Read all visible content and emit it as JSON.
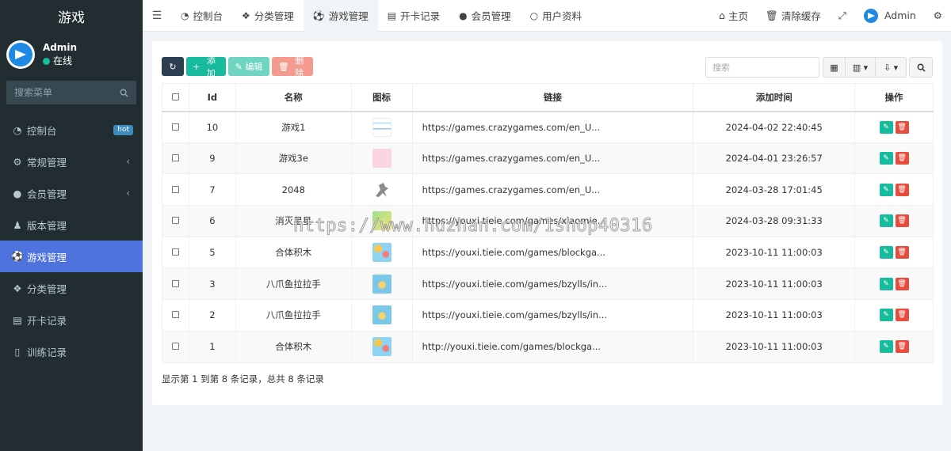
{
  "sidebar": {
    "brand": "游戏",
    "user": {
      "name": "Admin",
      "status": "在线"
    },
    "search_placeholder": "搜索菜单",
    "items": [
      {
        "label": "控制台",
        "icon": "dashboard-icon",
        "badge": "hot"
      },
      {
        "label": "常规管理",
        "icon": "cogs-icon"
      },
      {
        "label": "会员管理",
        "icon": "user-circle-icon"
      },
      {
        "label": "版本管理",
        "icon": "users-icon"
      },
      {
        "label": "游戏管理",
        "icon": "futbol-icon",
        "active": true
      },
      {
        "label": "分类管理",
        "icon": "cubes-icon"
      },
      {
        "label": "开卡记录",
        "icon": "id-card-icon"
      },
      {
        "label": "训练记录",
        "icon": "book-icon"
      }
    ]
  },
  "topbar": {
    "tabs": [
      {
        "label": "控制台",
        "icon": "dashboard-icon"
      },
      {
        "label": "分类管理",
        "icon": "cubes-icon"
      },
      {
        "label": "游戏管理",
        "icon": "futbol-icon",
        "active": true
      },
      {
        "label": "开卡记录",
        "icon": "id-card-icon"
      },
      {
        "label": "会员管理",
        "icon": "user-icon"
      },
      {
        "label": "用户资料",
        "icon": "circle-icon"
      }
    ],
    "home_label": "主页",
    "clear_cache_label": "清除缓存",
    "user_label": "Admin"
  },
  "toolbar": {
    "add_label": "添加",
    "edit_label": "编辑",
    "delete_label": "删除",
    "search_placeholder": "搜索"
  },
  "table": {
    "headers": {
      "id": "Id",
      "name": "名称",
      "icon": "图标",
      "link": "链接",
      "time": "添加时间",
      "ops": "操作"
    },
    "rows": [
      {
        "id": "10",
        "name": "游戏1",
        "link": "https://games.crazygames.com/en_U...",
        "time": "2024-04-02 22:40:45"
      },
      {
        "id": "9",
        "name": "游戏3e",
        "link": "https://games.crazygames.com/en_U...",
        "time": "2024-04-01 23:26:57"
      },
      {
        "id": "7",
        "name": "2048",
        "link": "https://games.crazygames.com/en_U...",
        "time": "2024-03-28 17:01:45"
      },
      {
        "id": "6",
        "name": "消灭星星",
        "link": "https://youxi.tieie.com/games/xiaomie...",
        "time": "2024-03-28 09:31:33"
      },
      {
        "id": "5",
        "name": "合体积木",
        "link": "https://youxi.tieie.com/games/blockga...",
        "time": "2023-10-11 11:00:03"
      },
      {
        "id": "3",
        "name": "八爪鱼拉拉手",
        "link": "https://youxi.tieie.com/games/bzylls/in...",
        "time": "2023-10-11 11:00:03"
      },
      {
        "id": "2",
        "name": "八爪鱼拉拉手",
        "link": "https://youxi.tieie.com/games/bzylls/in...",
        "time": "2023-10-11 11:00:03"
      },
      {
        "id": "1",
        "name": "合体积木",
        "link": "http://youxi.tieie.com/games/blockga...",
        "time": "2023-10-11 11:00:03"
      }
    ]
  },
  "pager_text": "显示第 1 到第 8 条记录，总共 8 条记录",
  "watermark": "https://www.huzhan.com/1shop40316",
  "colors": {
    "accent": "#4e73df",
    "success": "#18bc9c",
    "danger": "#e74c3c",
    "sidebar": "#222d32"
  }
}
